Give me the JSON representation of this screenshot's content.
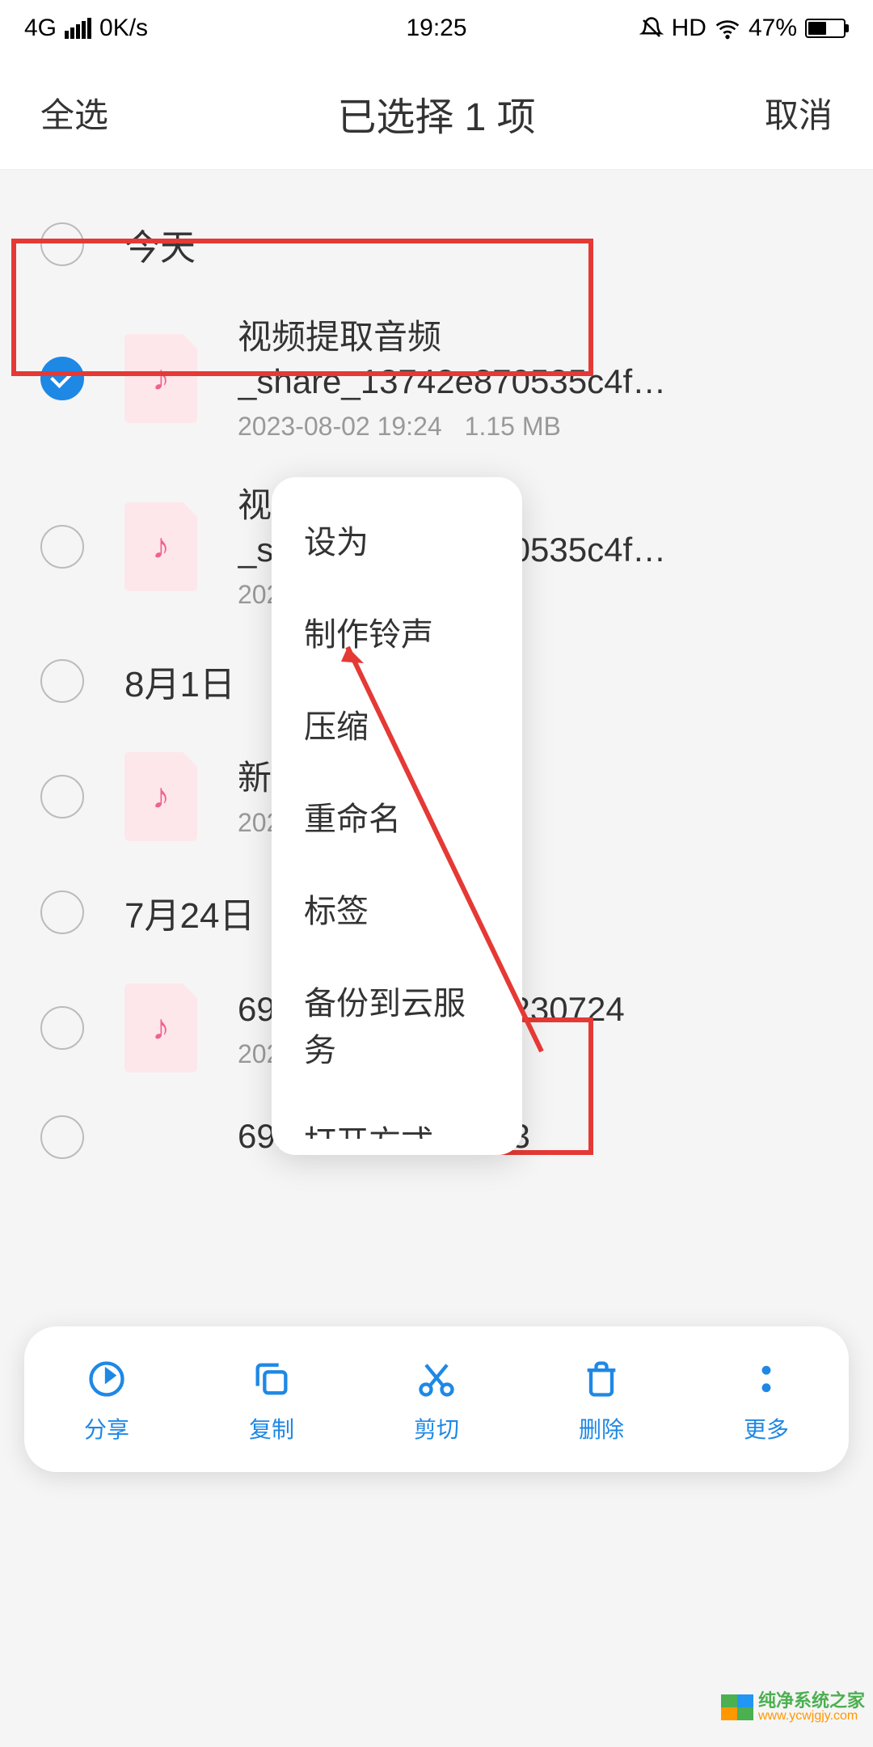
{
  "status": {
    "network": "4G",
    "speed": "0K/s",
    "time": "19:25",
    "hd": "HD",
    "battery_pct": "47%"
  },
  "header": {
    "select_all": "全选",
    "title": "已选择 1 项",
    "cancel": "取消"
  },
  "sections": [
    {
      "title": "今天",
      "items": [
        {
          "name": "视频提取音频_share_13742e870535c4f…",
          "date": "2023-08-02 19:24",
          "size": "1.15 MB",
          "checked": true
        },
        {
          "name": "视频提取音频_share_13742e870535c4f…",
          "date": "2023-08",
          "size": "",
          "checked": false
        }
      ]
    },
    {
      "title": "8月1日",
      "items": [
        {
          "name": "新录音",
          "date": "2023-08",
          "size": "",
          "checked": false
        }
      ]
    },
    {
      "title": "7月24日",
      "items": [
        {
          "name": "69104               20230724",
          "date": "2023-07",
          "size": "",
          "checked": false
        },
        {
          "name": "69104               np3",
          "date": "",
          "size": "",
          "checked": false
        }
      ]
    }
  ],
  "popup": {
    "items": [
      "设为",
      "制作铃声",
      "压缩",
      "重命名",
      "标签",
      "备份到云服务",
      "打开方式"
    ]
  },
  "bottom": {
    "share": "分享",
    "copy": "复制",
    "cut": "剪切",
    "delete": "删除",
    "more": "更多"
  },
  "watermark": {
    "text": "纯净系统之家",
    "url": "www.ycwjgjy.com"
  }
}
